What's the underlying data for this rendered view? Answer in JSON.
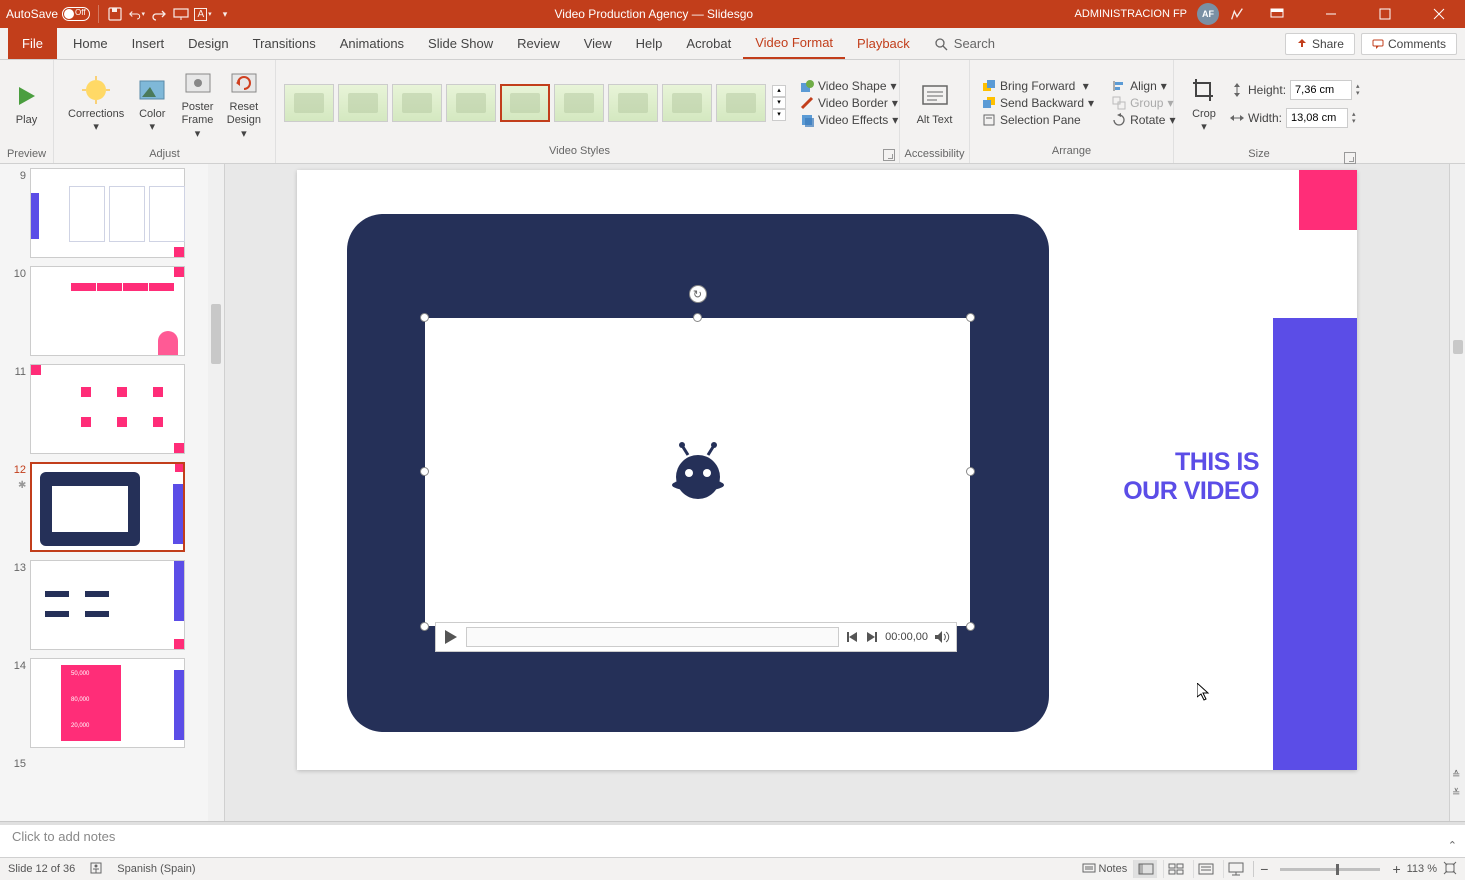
{
  "titlebar": {
    "autosave": "AutoSave",
    "autosave_state": "Off",
    "title": "Video Production Agency — Slidesgo",
    "user_name": "ADMINISTRACION FP",
    "user_initials": "AF"
  },
  "tabs": {
    "file": "File",
    "list": [
      "Home",
      "Insert",
      "Design",
      "Transitions",
      "Animations",
      "Slide Show",
      "Review",
      "View",
      "Help",
      "Acrobat",
      "Video Format",
      "Playback"
    ],
    "active": "Video Format",
    "search_icon": "search-icon",
    "search": "Search",
    "share": "Share",
    "comments": "Comments"
  },
  "ribbon": {
    "preview": {
      "play": "Play",
      "label": "Preview"
    },
    "adjust": {
      "corrections": "Corrections",
      "color": "Color",
      "poster_frame": "Poster Frame",
      "reset_design": "Reset Design",
      "label": "Adjust"
    },
    "video_styles": {
      "label": "Video Styles",
      "video_shape": "Video Shape",
      "video_border": "Video Border",
      "video_effects": "Video Effects"
    },
    "accessibility": {
      "alt_text": "Alt Text",
      "label": "Accessibility"
    },
    "arrange": {
      "bring_forward": "Bring Forward",
      "send_backward": "Send Backward",
      "selection_pane": "Selection Pane",
      "align": "Align",
      "group": "Group",
      "rotate": "Rotate",
      "label": "Arrange"
    },
    "size": {
      "crop": "Crop",
      "height_label": "Height:",
      "height_value": "7,36 cm",
      "width_label": "Width:",
      "width_value": "13,08 cm",
      "label": "Size"
    }
  },
  "thumbs": {
    "visible": [
      "9",
      "10",
      "11",
      "12",
      "13",
      "14",
      "15"
    ]
  },
  "slide": {
    "title_line1": "THIS IS",
    "title_line2": "OUR VIDEO",
    "video_time": "00:00,00"
  },
  "notes": {
    "placeholder": "Click to add notes"
  },
  "status": {
    "slide_counter": "Slide 12 of 36",
    "language": "Spanish (Spain)",
    "notes_btn": "Notes",
    "zoom": "113 %"
  }
}
